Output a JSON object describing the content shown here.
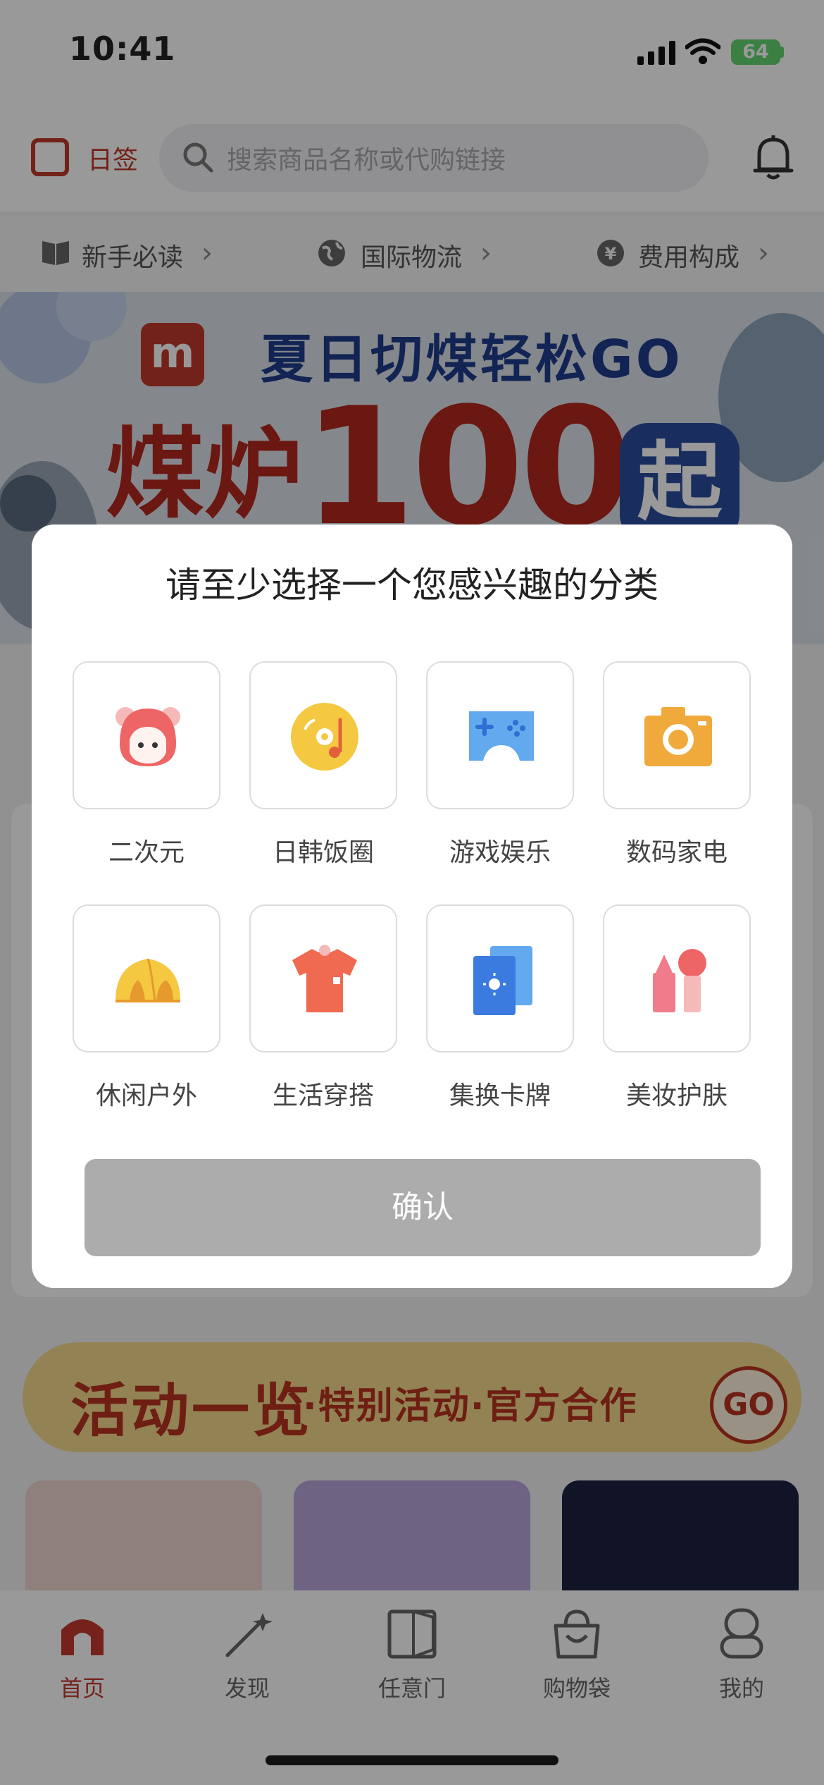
{
  "status_bar": {
    "time": "10:41",
    "battery": "64"
  },
  "header": {
    "checkin_label": "日签",
    "search_placeholder": "搜索商品名称或代购链接"
  },
  "quick_links": [
    {
      "label": "新手必读"
    },
    {
      "label": "国际物流"
    },
    {
      "label": "费用构成"
    }
  ],
  "banner": {
    "title": "夏日切煤轻松GO",
    "big_text": "煤炉",
    "number": "100",
    "suffix": "起",
    "logo": "m"
  },
  "activity": {
    "title": "活动一览",
    "subtitle": "·特别活动·官方合作",
    "go": "GO"
  },
  "modal": {
    "title": "请至少选择一个您感兴趣的分类",
    "categories": [
      {
        "label": "二次元",
        "icon": "anime-girl-icon"
      },
      {
        "label": "日韩饭圈",
        "icon": "music-disc-icon"
      },
      {
        "label": "游戏娱乐",
        "icon": "gamepad-icon"
      },
      {
        "label": "数码家电",
        "icon": "camera-icon"
      },
      {
        "label": "休闲户外",
        "icon": "tent-icon"
      },
      {
        "label": "生活穿搭",
        "icon": "tshirt-icon"
      },
      {
        "label": "集换卡牌",
        "icon": "trading-cards-icon"
      },
      {
        "label": "美妆护肤",
        "icon": "cosmetics-icon"
      }
    ],
    "confirm_label": "确认"
  },
  "tabbar": {
    "items": [
      {
        "label": "首页",
        "active": true
      },
      {
        "label": "发现",
        "active": false
      },
      {
        "label": "任意门",
        "active": false
      },
      {
        "label": "购物袋",
        "active": false
      },
      {
        "label": "我的",
        "active": false
      }
    ]
  },
  "colors": {
    "brand_red": "#c43a31",
    "disabled_button": "#acacac",
    "overlay": "rgba(0,0,0,0.40)"
  }
}
